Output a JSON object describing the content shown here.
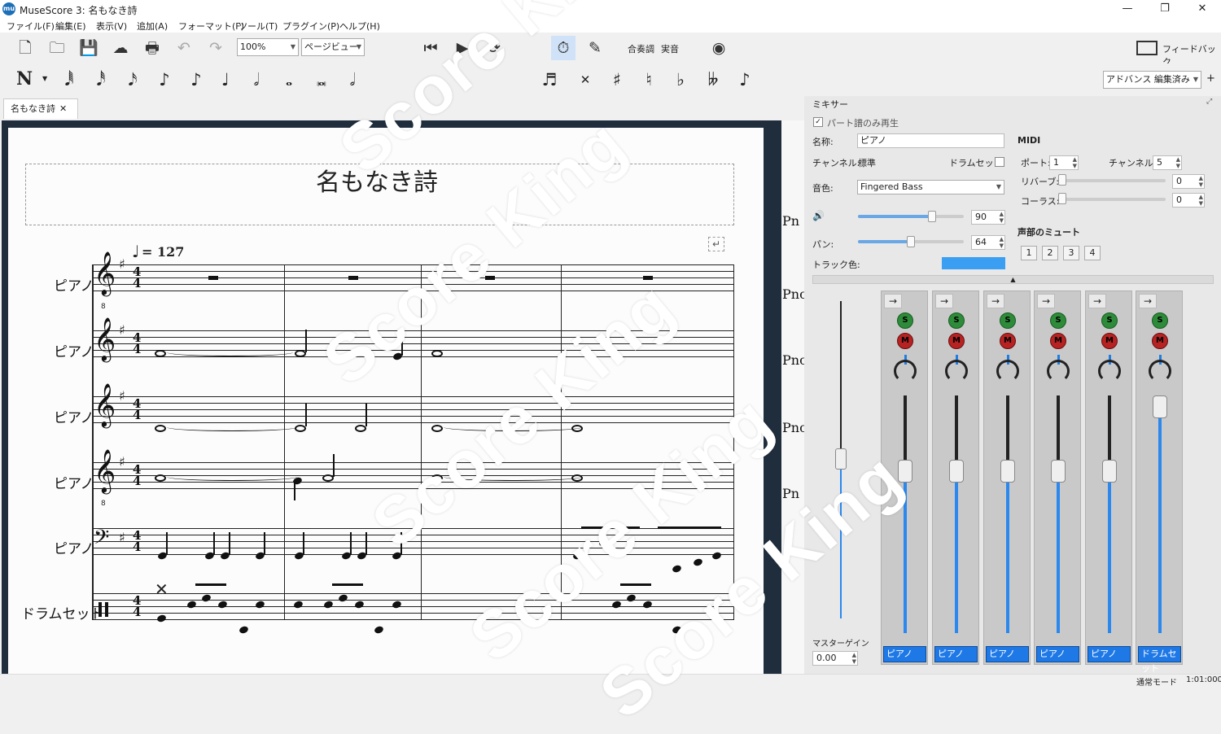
{
  "window": {
    "app_icon": "mu",
    "title": "MuseScore 3: 名もなき詩",
    "minimize": "—",
    "maximize": "❐",
    "close": "✕"
  },
  "menu": [
    "ファイル(F)",
    "編集(E)",
    "表示(V)",
    "追加(A)",
    "フォーマット(F)",
    "ツール(T)",
    "プラグイン(P)",
    "ヘルプ(H)"
  ],
  "toolbar": {
    "zoom": "100%",
    "view_mode": "ページビュー",
    "concert_pitch": "合奏調",
    "sound": "実音",
    "feedback": "フィードバック",
    "workspace": "アドバンス 編集済み",
    "add_workspace": "+"
  },
  "tab": {
    "label": "名もなき詩",
    "close": "✕"
  },
  "score": {
    "title": "名もなき詩",
    "tempo": "= 127",
    "instruments": [
      "ピアノ",
      "ピアノ",
      "ピアノ",
      "ピアノ",
      "ピアノ",
      "ドラムセット"
    ],
    "next_page_parts": [
      "Pn",
      "Pno",
      "Pno",
      "Pno",
      "Pn"
    ]
  },
  "mixer": {
    "header": "ミキサー",
    "part_only_play": "パート譜のみ再生",
    "name_label": "名称:",
    "name_value": "ピアノ",
    "channel_label": "チャンネル:",
    "channel_value": "標準",
    "drumset_label": "ドラムセット",
    "sound_label": "音色:",
    "sound_value": "Fingered Bass",
    "volume_value": "90",
    "volume": 0.7,
    "pan_label": "パン:",
    "pan_value": "64",
    "pan": 0.5,
    "track_color_label": "トラック色:",
    "track_color": "#3a9ef2",
    "midi_header": "MIDI",
    "port_label": "ポート:",
    "port_value": "1",
    "midi_channel_label": "チャンネル:",
    "midi_channel_value": "5",
    "reverb_label": "リバーブ:",
    "reverb_value": "0",
    "chorus_label": "コーラス:",
    "chorus_value": "0",
    "voice_mute_header": "声部のミュート",
    "voices": [
      "1",
      "2",
      "3",
      "4"
    ],
    "master_gain_label": "マスターゲイン",
    "master_gain_value": "0.00",
    "strips": [
      {
        "name": "ピアノ",
        "solo": "S",
        "mute": "M",
        "fader": 0.73
      },
      {
        "name": "ピアノ",
        "solo": "S",
        "mute": "M",
        "fader": 0.73
      },
      {
        "name": "ピアノ",
        "solo": "S",
        "mute": "M",
        "fader": 0.73
      },
      {
        "name": "ピアノ",
        "solo": "S",
        "mute": "M",
        "fader": 0.73
      },
      {
        "name": "ピアノ",
        "solo": "S",
        "mute": "M",
        "fader": 0.73
      },
      {
        "name": "ドラムセット",
        "solo": "S",
        "mute": "M",
        "fader": 1.0
      }
    ]
  },
  "status": {
    "mode": "通常モード",
    "position": "1:01:000"
  },
  "watermark": "Score King"
}
